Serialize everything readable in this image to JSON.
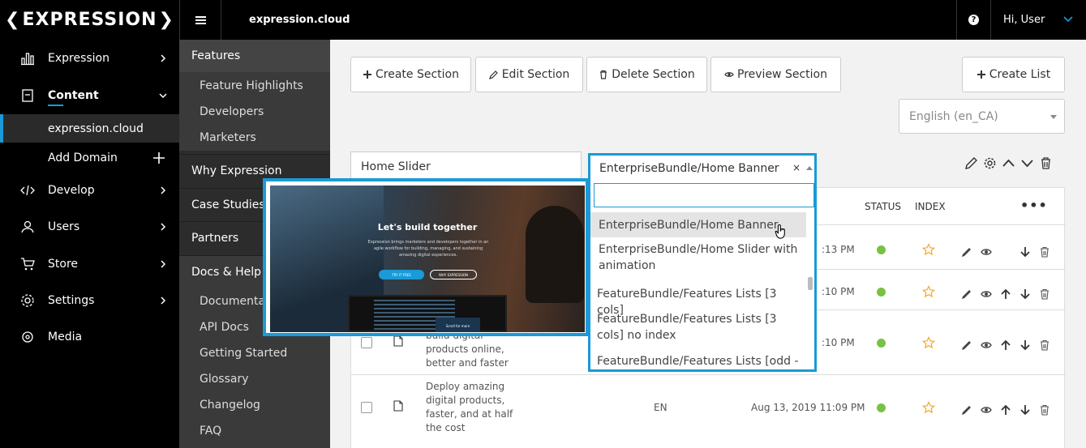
{
  "topbar": {
    "logo": "EXPRESSION",
    "domain": "expression.cloud",
    "help": "?",
    "user": "Hi, User"
  },
  "sidebar": {
    "items": [
      {
        "label": "Expression"
      },
      {
        "label": "Content"
      },
      {
        "label": "expression.cloud"
      },
      {
        "label": "Add Domain"
      },
      {
        "label": "Develop"
      },
      {
        "label": "Users"
      },
      {
        "label": "Store"
      },
      {
        "label": "Settings"
      },
      {
        "label": "Media"
      }
    ]
  },
  "sidebar2": {
    "features": "Features",
    "features_items": [
      "Feature Highlights",
      "Developers",
      "Marketers"
    ],
    "why": "Why Expression",
    "cases": "Case Studies",
    "partners": "Partners",
    "docs": "Docs & Help",
    "docs_items": [
      "Documentation",
      "API Docs",
      "Getting Started",
      "Glossary",
      "Changelog",
      "FAQ"
    ]
  },
  "toolbar": {
    "create_section": "Create Section",
    "edit_section": "Edit Section",
    "delete_section": "Delete Section",
    "preview_section": "Preview Section",
    "create_list": "Create List",
    "language": "English (en_CA)"
  },
  "section": {
    "name": "Home Slider"
  },
  "dropdown": {
    "selected": "EnterpriseBundle/Home Banner",
    "clear": "×",
    "search_value": "",
    "options": [
      "EnterpriseBundle/Home Banner",
      "EnterpriseBundle/Home Slider with animation",
      "FeatureBundle/Features Lists [3 cols]",
      "FeatureBundle/Features Lists [3 cols] no index",
      "FeatureBundle/Features Lists [odd -"
    ]
  },
  "table": {
    "headers": {
      "status": "STATUS",
      "index": "INDEX",
      "more": "•••"
    },
    "rows": [
      {
        "time": ":13 PM"
      },
      {
        "time": ":10 PM"
      },
      {
        "title": "build digital products online, better and faster",
        "time": ":10 PM"
      },
      {
        "title": "Deploy amazing digital products, faster, and at half the cost",
        "lang": "EN",
        "date": "Aug 13, 2019 11:09 PM"
      }
    ]
  },
  "preview": {
    "heading": "Let's build together",
    "text": "Expression brings marketers and developers together in an agile workflow for building, managing, and sustaining amazing digital experiences.",
    "btn1": "TRY IT FREE",
    "btn2": "WHY EXPRESSION",
    "screen": "Scroll for more"
  },
  "colors": {
    "accent": "#1a9ad6",
    "status": "#7ac143",
    "star": "#f0a830"
  }
}
